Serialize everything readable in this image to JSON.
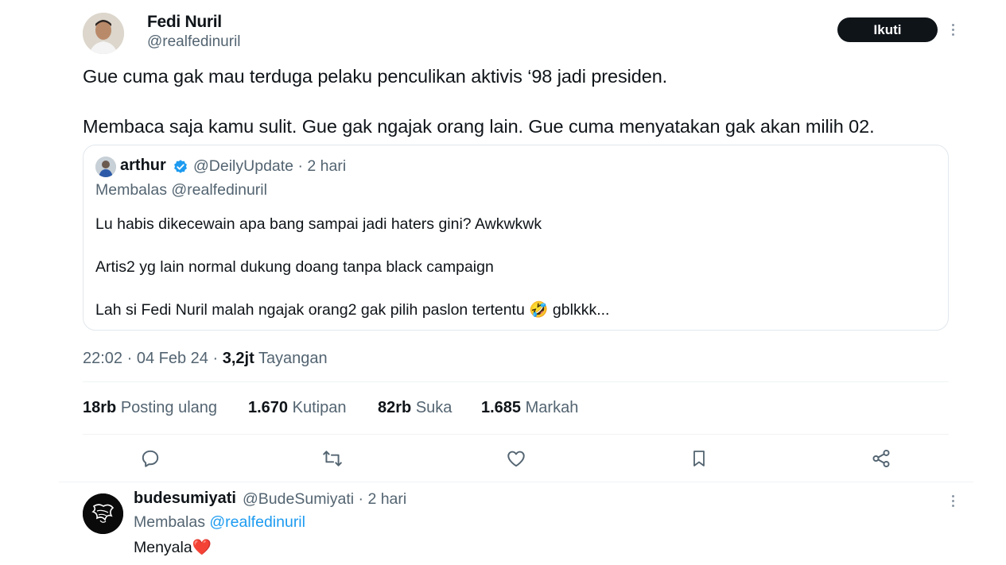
{
  "tweet": {
    "author_name": "Fedi Nuril",
    "author_handle": "@realfedinuril",
    "follow_label": "Ikuti",
    "text_line1": "Gue cuma gak mau terduga pelaku penculikan aktivis ‘98 jadi presiden.",
    "text_line2": "Membaca saja kamu sulit. Gue gak ngajak orang lain. Gue cuma menyatakan gak akan milih 02.",
    "time": "22:02",
    "date": "04 Feb 24",
    "views_count": "3,2jt",
    "views_label": "Tayangan"
  },
  "quote": {
    "name": "arthur",
    "handle": "@DeilyUpdate",
    "age": "2 hari",
    "reply_to": "Membalas @realfedinuril",
    "line1": "Lu habis dikecewain apa bang sampai jadi haters gini? Awkwkwk",
    "line2": "Artis2 yg lain normal dukung doang tanpa black campaign",
    "line3": "Lah si Fedi Nuril malah ngajak orang2 gak pilih paslon tertentu 🤣 gblkkk..."
  },
  "stats": {
    "reposts_count": "18rb",
    "reposts_label": "Posting ulang",
    "quotes_count": "1.670",
    "quotes_label": "Kutipan",
    "likes_count": "82rb",
    "likes_label": "Suka",
    "bookmarks_count": "1.685",
    "bookmarks_label": "Markah"
  },
  "icons": {
    "reply": "reply-icon",
    "repost": "repost-icon",
    "like": "heart-icon",
    "bookmark": "bookmark-icon",
    "share": "share-icon",
    "more": "more-icon",
    "verified": "verified-badge-icon"
  },
  "reply": {
    "name": "budesumiyati",
    "handle": "@BudeSumiyati",
    "age": "2 hari",
    "reply_prefix": "Membalas",
    "reply_to": "@realfedinuril",
    "text": "Menyala❤️"
  },
  "colors": {
    "link": "#1d9bf0",
    "secondary_text": "#536471",
    "verified": "#1d9bf0"
  }
}
